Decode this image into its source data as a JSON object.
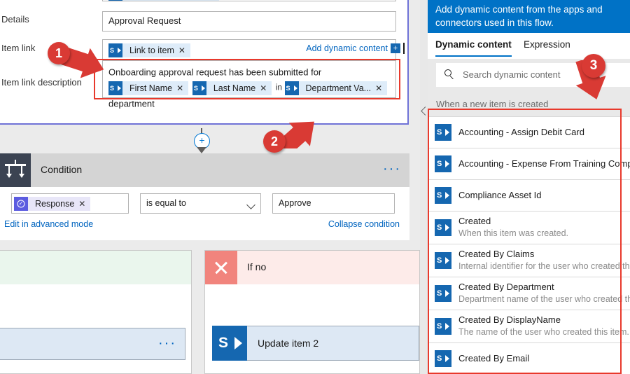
{
  "form": {
    "fields": [
      {
        "label": "Details",
        "value": "Approval Request"
      },
      {
        "label": "Item link",
        "value": ""
      },
      {
        "label": "Item link description",
        "value": ""
      }
    ],
    "details_label": "Details",
    "details_value": "Approval Request",
    "item_link_label": "Item link",
    "item_link_token": "Link to item",
    "item_link_desc_label": "Item link description",
    "desc_text_1": "Onboarding approval request has been submitted for",
    "desc_token_1": "First Name",
    "desc_token_2": "Last Name",
    "desc_text_2": "in",
    "desc_token_3": "Department Va...",
    "desc_text_3": "department",
    "add_dynamic_content": "Add dynamic content",
    "add_plus": "+",
    "token_remove": "✕"
  },
  "condition": {
    "title": "Condition",
    "more": "···",
    "left_token": "Response",
    "operator": "is equal to",
    "value": "Approve",
    "advanced_link": "Edit in advanced mode",
    "collapse_link": "Collapse condition",
    "connector_plus": "+"
  },
  "branches": {
    "yes_more": "···",
    "no_title": "If no",
    "no_card_label": "Update item 2"
  },
  "panel": {
    "banner": "Add dynamic content from the apps and connectors used in this flow.",
    "tabs": [
      {
        "label": "Dynamic content",
        "active": true
      },
      {
        "label": "Expression",
        "active": false
      }
    ],
    "tab_dynamic": "Dynamic content",
    "tab_expression": "Expression",
    "search_placeholder": "Search dynamic content",
    "group_title": "When a new item is created",
    "items": [
      {
        "name": "Accounting - Assign Debit Card",
        "desc": ""
      },
      {
        "name": "Accounting - Expense From Training Complet",
        "desc": ""
      },
      {
        "name": "Compliance Asset Id",
        "desc": ""
      },
      {
        "name": "Created",
        "desc": "When this item was created."
      },
      {
        "name": "Created By Claims",
        "desc": "Internal identifier for the user who created this"
      },
      {
        "name": "Created By Department",
        "desc": "Department name of the user who created this"
      },
      {
        "name": "Created By DisplayName",
        "desc": "The name of the user who created this item."
      },
      {
        "name": "Created By Email",
        "desc": ""
      }
    ]
  },
  "annotations": {
    "badge_1": "1",
    "badge_2": "2",
    "badge_3": "3"
  },
  "colors": {
    "accent_blue": "#0072c6",
    "link_blue": "#0064bf",
    "sharepoint_blue": "#1567b0",
    "approval_purple": "#5c5ce0",
    "annotation_red": "#d93a34",
    "yes_green": "#eaf6ed",
    "no_red": "#fdebe9"
  }
}
